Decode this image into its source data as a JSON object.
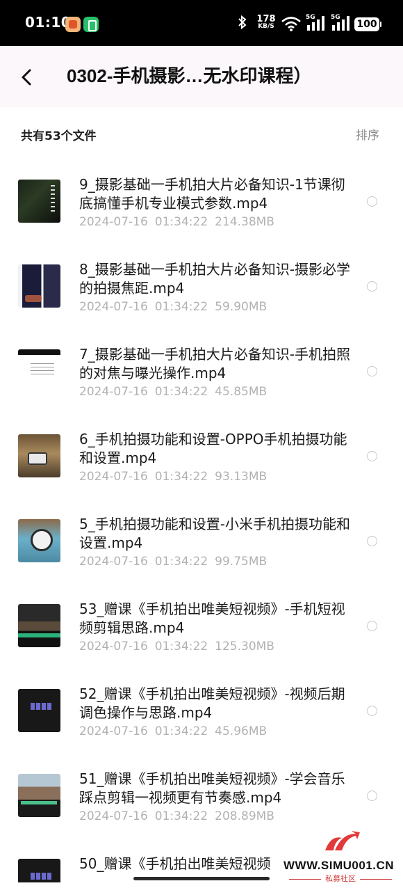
{
  "status_bar": {
    "time": "01:10",
    "net_speed_value": "178",
    "net_speed_unit": "KB/S",
    "sim1_label": "5G",
    "sim2_label": "5G",
    "battery": "100"
  },
  "header": {
    "title": "0302-手机摄影…无水印课程）"
  },
  "summary": {
    "count_label": "共有53个文件",
    "sort_label": "排序"
  },
  "files": [
    {
      "name": "9_摄影基础一手机拍大片必备知识-1节课彻底搞懂手机专业模式参数.mp4",
      "date": "2024-07-16",
      "time": "01:34:22",
      "size": "214.38MB",
      "thumb": "t-dark"
    },
    {
      "name": "8_摄影基础一手机拍大片必备知识-摄影必学的拍摄焦距.mp4",
      "date": "2024-07-16",
      "time": "01:34:22",
      "size": "59.90MB",
      "thumb": "t-night"
    },
    {
      "name": "7_摄影基础一手机拍大片必备知识-手机拍照的对焦与曝光操作.mp4",
      "date": "2024-07-16",
      "time": "01:34:22",
      "size": "45.85MB",
      "thumb": "t-doc"
    },
    {
      "name": "6_手机拍摄功能和设置-OPPO手机拍摄功能和设置.mp4",
      "date": "2024-07-16",
      "time": "01:34:22",
      "size": "93.13MB",
      "thumb": "t-camera"
    },
    {
      "name": "5_手机拍摄功能和设置-小米手机拍摄功能和设置.mp4",
      "date": "2024-07-16",
      "time": "01:34:22",
      "size": "99.75MB",
      "thumb": "t-clock"
    },
    {
      "name": "53_赠课《手机拍出唯美短视频》-手机短视频剪辑思路.mp4",
      "date": "2024-07-16",
      "time": "01:34:22",
      "size": "125.30MB",
      "thumb": "t-edit1"
    },
    {
      "name": "52_赠课《手机拍出唯美短视频》-视频后期调色操作与思路.mp4",
      "date": "2024-07-16",
      "time": "01:34:22",
      "size": "45.96MB",
      "thumb": "t-edit2"
    },
    {
      "name": "51_赠课《手机拍出唯美短视频》-学会音乐踩点剪辑一视频更有节奏感.mp4",
      "date": "2024-07-16",
      "time": "01:34:22",
      "size": "208.89MB",
      "thumb": "t-street"
    },
    {
      "name": "50_赠课《手机拍出唯美短视频",
      "date": "",
      "time": "",
      "size": "",
      "thumb": "t-edit2"
    }
  ],
  "watermark": {
    "url": "WWW.SIMU001.CN",
    "subtitle": "私募社区"
  },
  "icons": {
    "back": "chevron-left-icon",
    "bluetooth": "bluetooth-icon",
    "wifi": "wifi-icon",
    "signal": "signal-icon",
    "battery": "battery-icon",
    "radio": "radio-unchecked-icon"
  },
  "colors": {
    "header_bg": "#fbf7fa",
    "meta_text": "#b2b2b2",
    "sort_text": "#8a8a8a",
    "watermark_red": "#d23a3a"
  }
}
